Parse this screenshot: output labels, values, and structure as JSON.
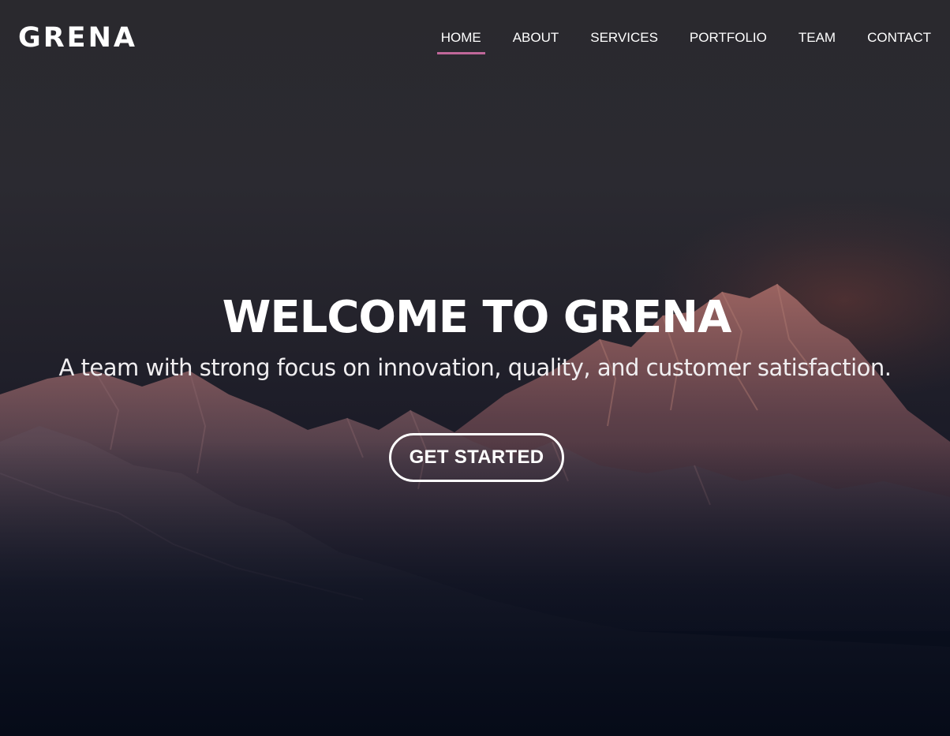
{
  "header": {
    "logo": "GRENA",
    "nav": [
      {
        "label": "HOME",
        "active": true
      },
      {
        "label": "ABOUT",
        "active": false
      },
      {
        "label": "SERVICES",
        "active": false
      },
      {
        "label": "PORTFOLIO",
        "active": false
      },
      {
        "label": "TEAM",
        "active": false
      },
      {
        "label": "CONTACT",
        "active": false
      }
    ]
  },
  "hero": {
    "title": "WELCOME TO GRENA",
    "subtitle": "A team with strong focus on innovation, quality, and customer satisfaction.",
    "cta_label": "GET STARTED",
    "background": "mountain-range-image"
  },
  "colors": {
    "accent": "#c0679a",
    "text": "#ffffff",
    "background_top": "#2a292e",
    "background_bottom": "#070c1a"
  }
}
